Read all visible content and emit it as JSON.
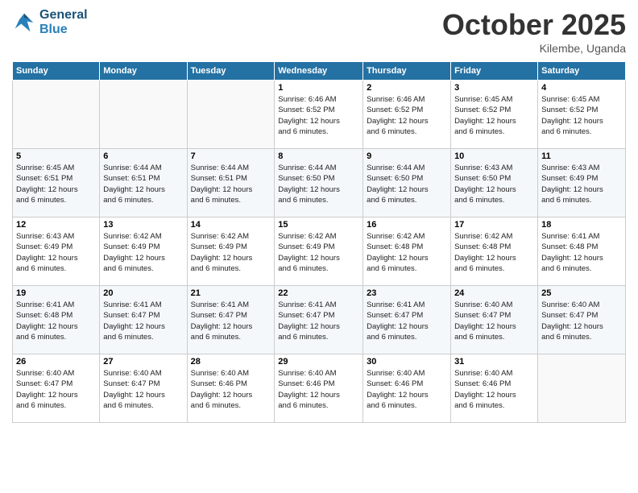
{
  "logo": {
    "line1": "General",
    "line2": "Blue"
  },
  "header": {
    "month": "October 2025",
    "location": "Kilembe, Uganda"
  },
  "weekdays": [
    "Sunday",
    "Monday",
    "Tuesday",
    "Wednesday",
    "Thursday",
    "Friday",
    "Saturday"
  ],
  "weeks": [
    [
      {
        "day": "",
        "info": ""
      },
      {
        "day": "",
        "info": ""
      },
      {
        "day": "",
        "info": ""
      },
      {
        "day": "1",
        "info": "Sunrise: 6:46 AM\nSunset: 6:52 PM\nDaylight: 12 hours and 6 minutes."
      },
      {
        "day": "2",
        "info": "Sunrise: 6:46 AM\nSunset: 6:52 PM\nDaylight: 12 hours and 6 minutes."
      },
      {
        "day": "3",
        "info": "Sunrise: 6:45 AM\nSunset: 6:52 PM\nDaylight: 12 hours and 6 minutes."
      },
      {
        "day": "4",
        "info": "Sunrise: 6:45 AM\nSunset: 6:52 PM\nDaylight: 12 hours and 6 minutes."
      }
    ],
    [
      {
        "day": "5",
        "info": "Sunrise: 6:45 AM\nSunset: 6:51 PM\nDaylight: 12 hours and 6 minutes."
      },
      {
        "day": "6",
        "info": "Sunrise: 6:44 AM\nSunset: 6:51 PM\nDaylight: 12 hours and 6 minutes."
      },
      {
        "day": "7",
        "info": "Sunrise: 6:44 AM\nSunset: 6:51 PM\nDaylight: 12 hours and 6 minutes."
      },
      {
        "day": "8",
        "info": "Sunrise: 6:44 AM\nSunset: 6:50 PM\nDaylight: 12 hours and 6 minutes."
      },
      {
        "day": "9",
        "info": "Sunrise: 6:44 AM\nSunset: 6:50 PM\nDaylight: 12 hours and 6 minutes."
      },
      {
        "day": "10",
        "info": "Sunrise: 6:43 AM\nSunset: 6:50 PM\nDaylight: 12 hours and 6 minutes."
      },
      {
        "day": "11",
        "info": "Sunrise: 6:43 AM\nSunset: 6:49 PM\nDaylight: 12 hours and 6 minutes."
      }
    ],
    [
      {
        "day": "12",
        "info": "Sunrise: 6:43 AM\nSunset: 6:49 PM\nDaylight: 12 hours and 6 minutes."
      },
      {
        "day": "13",
        "info": "Sunrise: 6:42 AM\nSunset: 6:49 PM\nDaylight: 12 hours and 6 minutes."
      },
      {
        "day": "14",
        "info": "Sunrise: 6:42 AM\nSunset: 6:49 PM\nDaylight: 12 hours and 6 minutes."
      },
      {
        "day": "15",
        "info": "Sunrise: 6:42 AM\nSunset: 6:49 PM\nDaylight: 12 hours and 6 minutes."
      },
      {
        "day": "16",
        "info": "Sunrise: 6:42 AM\nSunset: 6:48 PM\nDaylight: 12 hours and 6 minutes."
      },
      {
        "day": "17",
        "info": "Sunrise: 6:42 AM\nSunset: 6:48 PM\nDaylight: 12 hours and 6 minutes."
      },
      {
        "day": "18",
        "info": "Sunrise: 6:41 AM\nSunset: 6:48 PM\nDaylight: 12 hours and 6 minutes."
      }
    ],
    [
      {
        "day": "19",
        "info": "Sunrise: 6:41 AM\nSunset: 6:48 PM\nDaylight: 12 hours and 6 minutes."
      },
      {
        "day": "20",
        "info": "Sunrise: 6:41 AM\nSunset: 6:47 PM\nDaylight: 12 hours and 6 minutes."
      },
      {
        "day": "21",
        "info": "Sunrise: 6:41 AM\nSunset: 6:47 PM\nDaylight: 12 hours and 6 minutes."
      },
      {
        "day": "22",
        "info": "Sunrise: 6:41 AM\nSunset: 6:47 PM\nDaylight: 12 hours and 6 minutes."
      },
      {
        "day": "23",
        "info": "Sunrise: 6:41 AM\nSunset: 6:47 PM\nDaylight: 12 hours and 6 minutes."
      },
      {
        "day": "24",
        "info": "Sunrise: 6:40 AM\nSunset: 6:47 PM\nDaylight: 12 hours and 6 minutes."
      },
      {
        "day": "25",
        "info": "Sunrise: 6:40 AM\nSunset: 6:47 PM\nDaylight: 12 hours and 6 minutes."
      }
    ],
    [
      {
        "day": "26",
        "info": "Sunrise: 6:40 AM\nSunset: 6:47 PM\nDaylight: 12 hours and 6 minutes."
      },
      {
        "day": "27",
        "info": "Sunrise: 6:40 AM\nSunset: 6:47 PM\nDaylight: 12 hours and 6 minutes."
      },
      {
        "day": "28",
        "info": "Sunrise: 6:40 AM\nSunset: 6:46 PM\nDaylight: 12 hours and 6 minutes."
      },
      {
        "day": "29",
        "info": "Sunrise: 6:40 AM\nSunset: 6:46 PM\nDaylight: 12 hours and 6 minutes."
      },
      {
        "day": "30",
        "info": "Sunrise: 6:40 AM\nSunset: 6:46 PM\nDaylight: 12 hours and 6 minutes."
      },
      {
        "day": "31",
        "info": "Sunrise: 6:40 AM\nSunset: 6:46 PM\nDaylight: 12 hours and 6 minutes."
      },
      {
        "day": "",
        "info": ""
      }
    ]
  ]
}
